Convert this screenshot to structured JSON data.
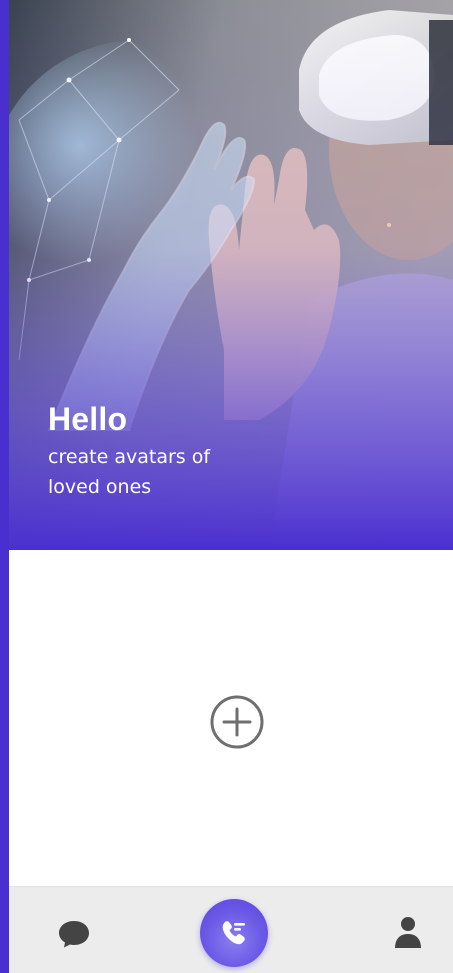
{
  "hero": {
    "title": "Hello",
    "subtitle": "create avatars of loved ones"
  },
  "content": {
    "add_icon": "plus-circle-icon"
  },
  "bottom_nav": {
    "items": [
      {
        "icon": "chat-bubble-icon"
      },
      {
        "icon": "phone-call-icon",
        "active": true
      },
      {
        "icon": "person-icon"
      }
    ]
  },
  "colors": {
    "accent": "#5a45dc",
    "frame": "#4a2fd0",
    "nav_background": "#ececec",
    "icon_gray": "#444444"
  }
}
